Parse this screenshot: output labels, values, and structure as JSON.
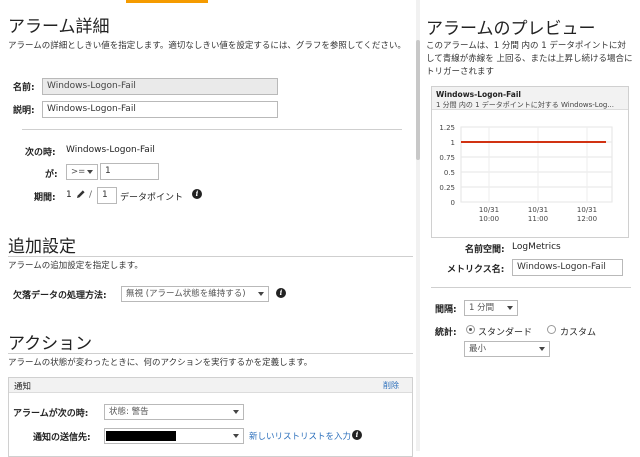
{
  "details": {
    "heading": "アラーム詳細",
    "description": "アラームの詳細としきい値を指定します。適切なしきい値を設定するには、グラフを参照してください。",
    "name_label": "名前:",
    "name_value": "Windows-Logon-Fail",
    "desc_label": "説明:",
    "desc_value": "Windows-Logon-Fail",
    "when_label": "次の時:",
    "when_value": "Windows-Logon-Fail",
    "is_label": "が:",
    "operator": ">=",
    "threshold": "1",
    "period_label": "期間:",
    "period_count": "1",
    "period_slash": "/",
    "datapoints_value": "1",
    "datapoints_label": "データポイント"
  },
  "additional": {
    "heading": "追加設定",
    "description": "アラームの追加設定を指定します。",
    "missing_label": "欠落データの処理方法:",
    "missing_value": "無視 (アラーム状態を維持する)"
  },
  "actions": {
    "heading": "アクション",
    "description": "アラームの状態が変わったときに、何のアクションを実行するかを定義します。",
    "notify_title": "通知",
    "delete_link": "削除",
    "when_label": "アラームが次の時:",
    "state_value": "状態: 警告",
    "sendto_label": "通知の送信先:",
    "new_list_link": "新しいリスト",
    "enter_list_link": "リストを入力"
  },
  "preview": {
    "heading": "アラームのプレビュー",
    "description": "このアラームは、1 分間 内の 1 データポイントに対して青線が赤線を 上回る、または上昇し続ける場合にトリガーされます",
    "chart_title": "Windows-Logon-Fail",
    "chart_subtitle": "1 分間 内の 1 データポイントに対する Windows-Log...",
    "namespace_label": "名前空間:",
    "namespace_value": "LogMetrics",
    "metric_label": "メトリクス名:",
    "metric_value": "Windows-Logon-Fail",
    "interval_label": "間隔:",
    "interval_value": "1 分間",
    "stat_label": "統計:",
    "stat_standard": "スタンダード",
    "stat_custom": "カスタム",
    "stat_value": "最小"
  },
  "colors": {
    "threshold_line": "#d13212",
    "link": "#2a6ebb",
    "accent_tab": "#f59b00"
  },
  "chart_data": {
    "type": "line",
    "ylim": [
      0,
      1.25
    ],
    "yticks": [
      "1.25",
      "1",
      "0.75",
      "0.5",
      "0.25",
      "0"
    ],
    "xticks": [
      {
        "date": "10/31",
        "time": "10:00"
      },
      {
        "date": "10/31",
        "time": "11:00"
      },
      {
        "date": "10/31",
        "time": "12:00"
      }
    ],
    "threshold": 1,
    "grid": true
  }
}
